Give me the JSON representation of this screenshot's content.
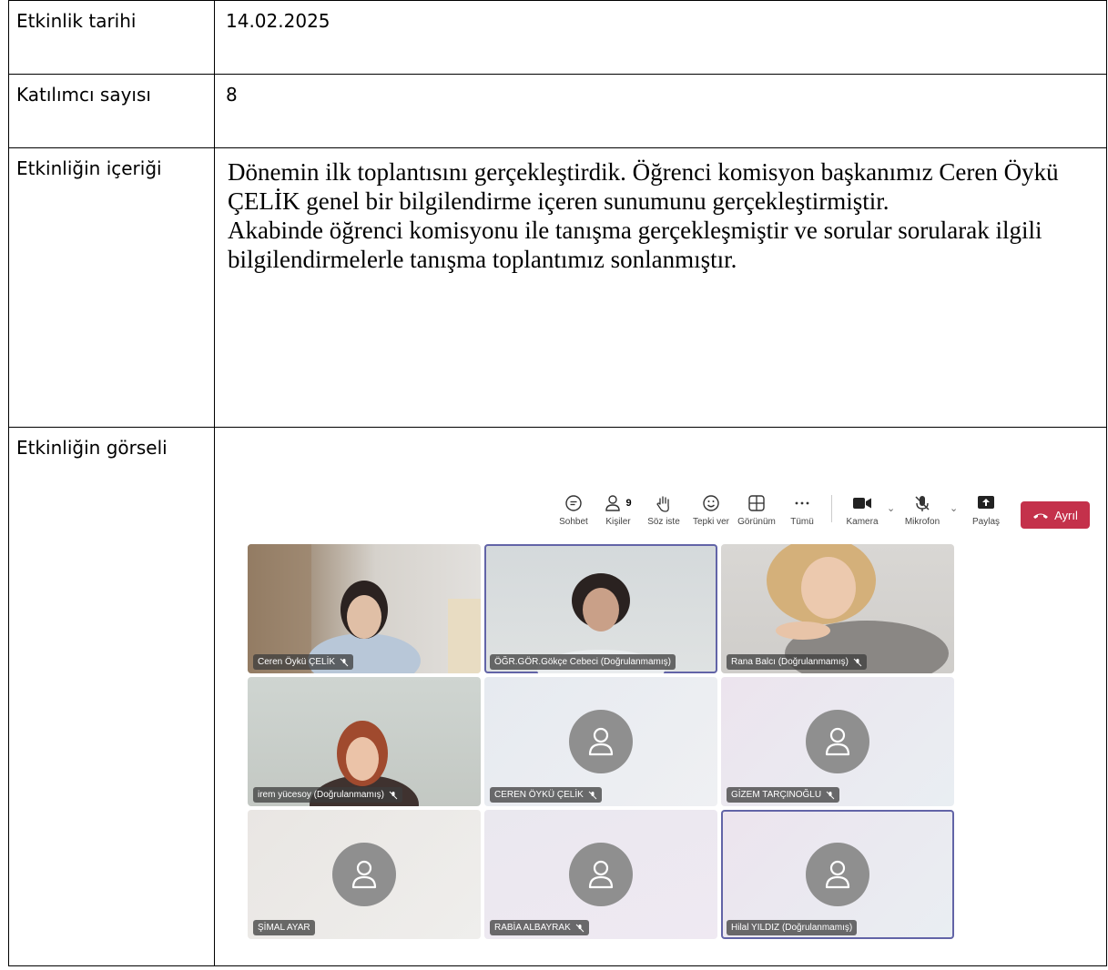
{
  "rows": {
    "date_label": "Etkinlik tarihi",
    "date_value": "14.02.2025",
    "count_label": "Katılımcı sayısı",
    "count_value": "8",
    "content_label": "Etkinliğin içeriği",
    "content_p1": "Dönemin ilk toplantısını gerçekleştirdik. Öğrenci komisyon başkanımız Ceren Öykü ÇELİK genel bir bilgilendirme içeren sunumunu gerçekleştirmiştir.",
    "content_p2": "Akabinde öğrenci komisyonu ile tanışma gerçekleşmiştir ve sorular sorularak ilgili bilgilendirmelerle tanışma toplantımız sonlanmıştır.",
    "image_label": "Etkinliğin görseli"
  },
  "meeting": {
    "toolbar": {
      "chat": "Sohbet",
      "people": "Kişiler",
      "people_count": "9",
      "raise_hand": "Söz iste",
      "react": "Tepki ver",
      "view": "Görünüm",
      "more": "Tümü",
      "camera": "Kamera",
      "mic": "Mikrofon",
      "share": "Paylaş",
      "leave": "Ayrıl"
    },
    "tiles": [
      {
        "name": "Ceren Öykü ÇELİK",
        "muted": true,
        "video": true
      },
      {
        "name": "ÖĞR.GÖR.Gökçe Cebeci (Doğrulanmamış)",
        "muted": false,
        "video": true
      },
      {
        "name": "Rana Balcı (Doğrulanmamış)",
        "muted": true,
        "video": true
      },
      {
        "name": "irem yücesoy (Doğrulanmamış)",
        "muted": true,
        "video": true
      },
      {
        "name": "CEREN ÖYKÜ ÇELİK",
        "muted": true,
        "video": false
      },
      {
        "name": "GİZEM TARÇINOĞLU",
        "muted": true,
        "video": false
      },
      {
        "name": "ŞİMAL AYAR",
        "muted": false,
        "video": false
      },
      {
        "name": "RABİA ALBAYRAK",
        "muted": true,
        "video": false
      },
      {
        "name": "Hilal YILDIZ (Doğrulanmamış)",
        "muted": false,
        "video": false
      }
    ]
  }
}
